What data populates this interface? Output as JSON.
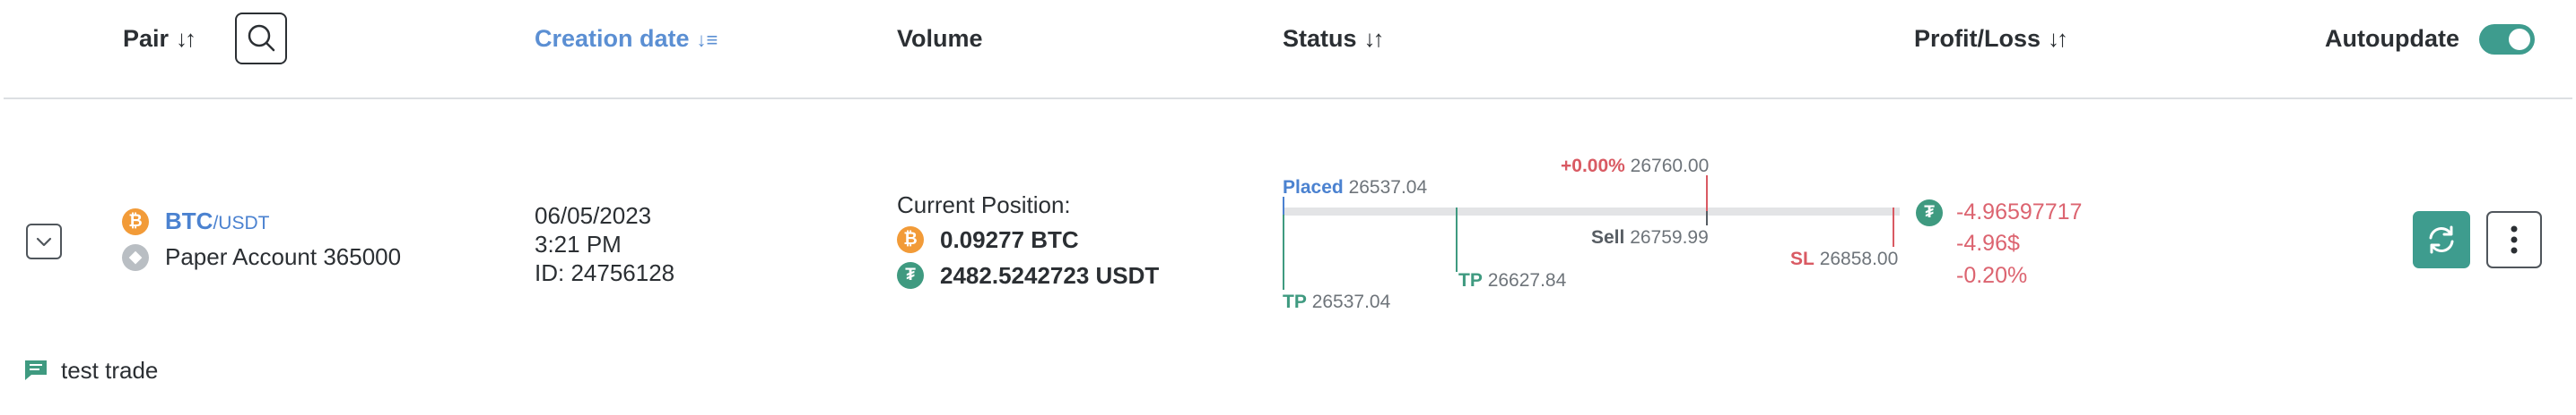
{
  "header": {
    "pair_label": "Pair",
    "creation_label": "Creation date",
    "volume_label": "Volume",
    "status_label": "Status",
    "pl_label": "Profit/Loss",
    "autoupdate_label": "Autoupdate",
    "sort_glyph": "↓↑",
    "sort_active_glyph": "↓≡",
    "autoupdate_on": true
  },
  "row": {
    "pair_base": "BTC",
    "pair_quote": "/USDT",
    "account": "Paper Account 365000",
    "date": "06/05/2023",
    "time": "3:21 PM",
    "id": "ID: 24756128",
    "position_label": "Current Position:",
    "btc_amount": "0.09277 BTC",
    "usdt_amount": "2482.5242723 USDT",
    "status": {
      "placed_label": "Placed",
      "placed_value": "26537.04",
      "top_pct": "+0.00%",
      "top_value": "26760.00",
      "sell_label": "Sell",
      "sell_value": "26759.99",
      "sl_label": "SL",
      "sl_value": "26858.00",
      "tp1_label": "TP",
      "tp1_value": "26537.04",
      "tp2_label": "TP",
      "tp2_value": "26627.84"
    },
    "pl_value": "-4.96597717",
    "pl_usd": "-4.96$",
    "pl_pct": "-0.20%",
    "note": "test trade"
  },
  "colors": {
    "accent": "#3e9c8e",
    "link": "#4b82d0",
    "loss": "#dc6470",
    "btc": "#f29b38",
    "usdt": "#3f9a80"
  },
  "icons": [
    "search-icon",
    "chevron-down-icon",
    "btc-icon",
    "paper-account-icon",
    "usdt-icon",
    "refresh-icon",
    "more-vertical-icon",
    "comment-icon"
  ]
}
